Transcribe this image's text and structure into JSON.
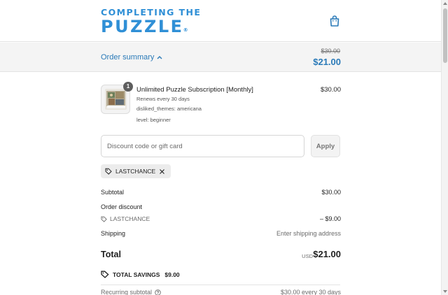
{
  "brand": {
    "logo_top": "COMPLETING THE",
    "logo_bottom": "PUZZLE",
    "logo_mark": "®",
    "color": "#2f8fd6"
  },
  "header": {
    "cart_icon": "shopping-bag-icon"
  },
  "summary": {
    "toggle_label": "Order summary",
    "toggle_icon": "chevron-up-icon",
    "original_price": "$30.00",
    "current_price": "$21.00",
    "accent_color": "#2a7ab8"
  },
  "product": {
    "quantity": "1",
    "title": "Unlimited Puzzle Subscription [Monthly]",
    "renews": "Renews every 30 days",
    "disliked_themes": "disliked_themes: americana",
    "level": "level: beginner",
    "price": "$30.00"
  },
  "discount": {
    "placeholder": "Discount code or gift card",
    "value": "",
    "apply_label": "Apply",
    "applied_code": "LASTCHANCE"
  },
  "totals": {
    "subtotal_label": "Subtotal",
    "subtotal_value": "$30.00",
    "order_discount_label": "Order discount",
    "discount_code": "LASTCHANCE",
    "discount_value": "– $9.00",
    "shipping_label": "Shipping",
    "shipping_value": "Enter shipping address",
    "total_label": "Total",
    "currency": "USD",
    "total_value": "$21.00",
    "savings_label": "TOTAL SAVINGS",
    "savings_value": "$9.00",
    "recurring_label": "Recurring subtotal",
    "recurring_value": "$30.00 every 30 days"
  }
}
